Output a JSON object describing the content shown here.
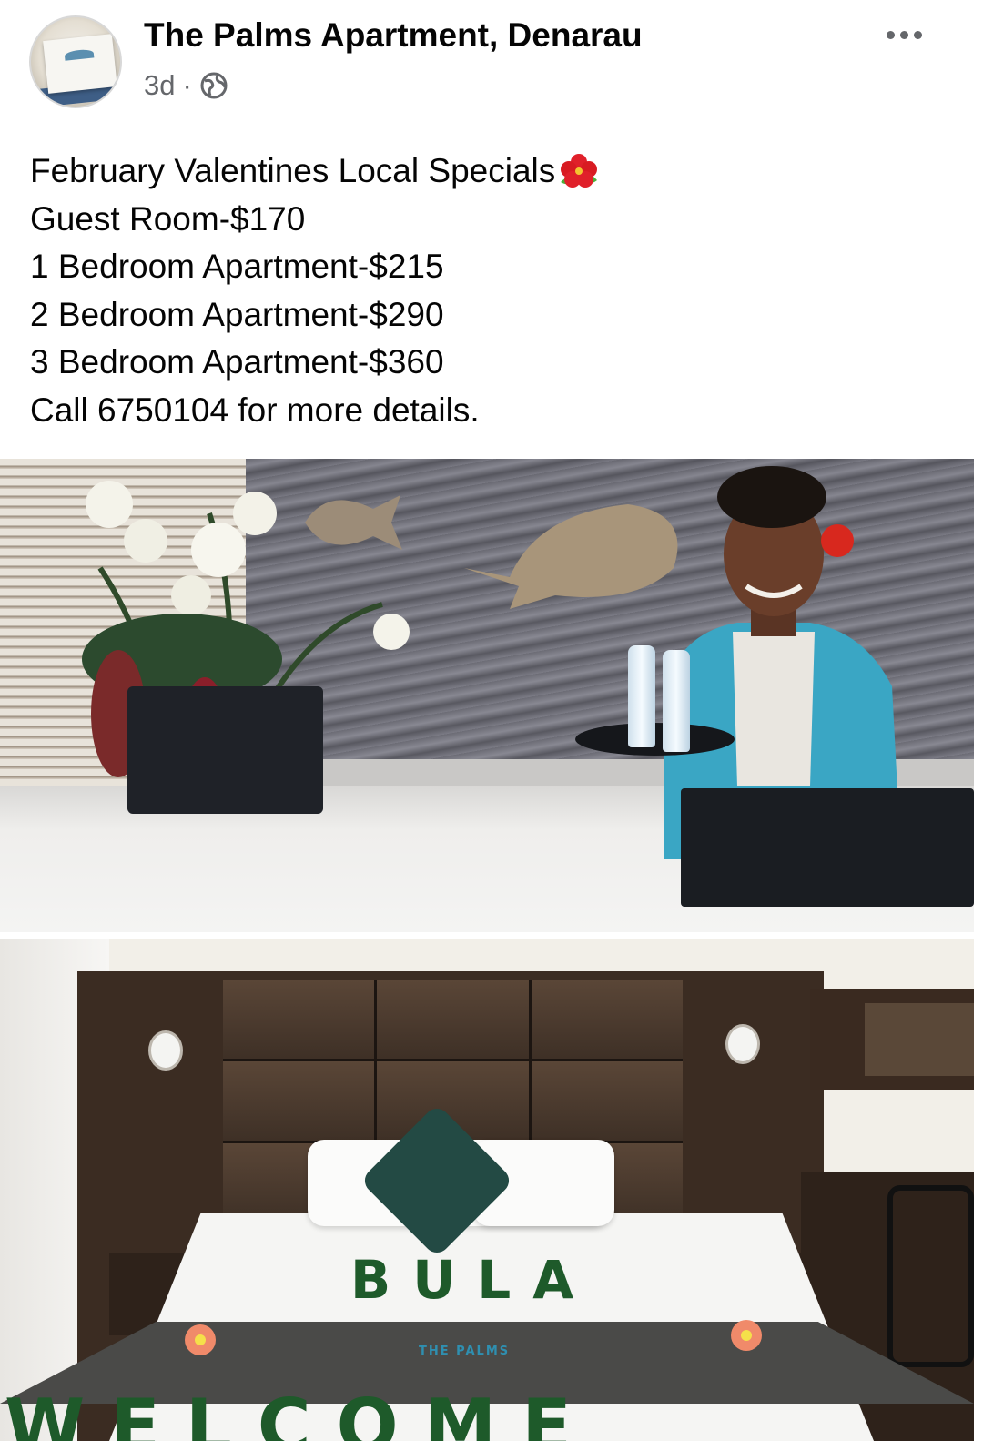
{
  "post": {
    "page_name": "The Palms Apartment, Denarau",
    "time": "3d",
    "separator": "·",
    "privacy_icon": "globe-icon",
    "more_icon": "more-options-icon",
    "text_lines": [
      "February Valentines Local Specials",
      "Guest Room-$170",
      "1 Bedroom Apartment-$215",
      "2 Bedroom Apartment-$290",
      "3 Bedroom Apartment-$360",
      "Call 6750104 for more details."
    ],
    "emoji_icon": "hibiscus-icon"
  },
  "photos": [
    {
      "name": "reception-photo"
    },
    {
      "name": "bedroom-photo",
      "bed_text": "BULA",
      "runner_text": "THE PALMS",
      "bottom_text": "WELCOME"
    }
  ],
  "colors": {
    "text_primary": "#050505",
    "text_secondary": "#65676b",
    "background": "#ffffff"
  }
}
